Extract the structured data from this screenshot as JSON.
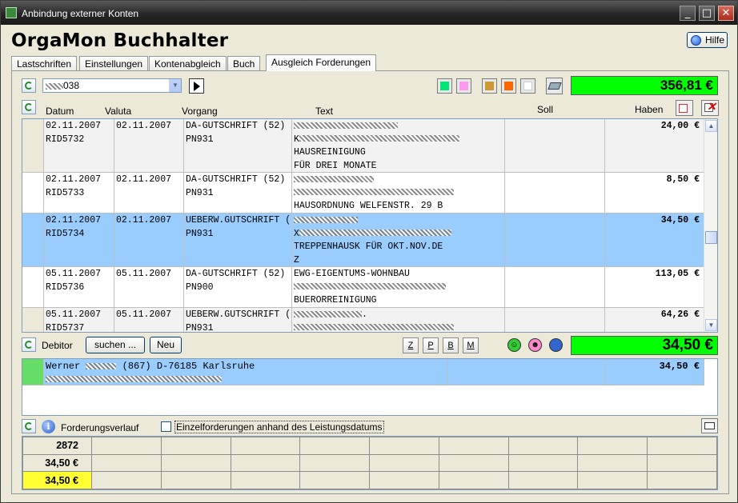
{
  "window": {
    "title": "Anbindung externer Konten",
    "min": "_",
    "max": "□",
    "close": "✕"
  },
  "app": {
    "title": "OrgaMon Buchhalter",
    "help": "Hilfe"
  },
  "tabs": [
    "Lastschriften",
    "Einstellungen",
    "Kontenabgleich",
    "Buch",
    "Ausgleich Forderungen"
  ],
  "account": {
    "value": "038"
  },
  "total_top": "356,81 €",
  "columns": {
    "datum": "Datum",
    "valuta": "Valuta",
    "vorgang": "Vorgang",
    "text": "Text",
    "soll": "Soll",
    "haben": "Haben"
  },
  "rows": [
    {
      "datum": "02.11.2007",
      "id": "RID5732",
      "valuta": "02.11.2007",
      "vorgang": "DA-GUTSCHRIFT (52)",
      "vorgang2": "PN931",
      "text": [
        "",
        "K",
        "HAUSREINIGUNG",
        "FÜR DREI MONATE"
      ],
      "haben": "24,00 €"
    },
    {
      "datum": "02.11.2007",
      "id": "RID5733",
      "valuta": "02.11.2007",
      "vorgang": "DA-GUTSCHRIFT (52)",
      "vorgang2": "PN931",
      "text": [
        "",
        "",
        "HAUSORDNUNG WELFENSTR. 29 B",
        ""
      ],
      "haben": "8,50 €"
    },
    {
      "datum": "02.11.2007",
      "id": "RID5734",
      "valuta": "02.11.2007",
      "vorgang": "UEBERW.GUTSCHRIFT (",
      "vorgang2": "PN931",
      "text": [
        "",
        "X",
        "TREPPENHAUSK FÜR OKT.NOV.DE",
        "Z"
      ],
      "haben": "34,50 €"
    },
    {
      "datum": "05.11.2007",
      "id": "RID5736",
      "valuta": "05.11.2007",
      "vorgang": "DA-GUTSCHRIFT (52)",
      "vorgang2": "PN900",
      "text": [
        "EWG-EIGENTUMS-WOHNBAU",
        "",
        "BUERORREINIGUNG",
        ""
      ],
      "haben": "113,05 €"
    },
    {
      "datum": "05.11.2007",
      "id": "RID5737",
      "valuta": "05.11.2007",
      "vorgang": "UEBERW.GUTSCHRIFT (",
      "vorgang2": "PN931",
      "text": [
        ".",
        "",
        "",
        ""
      ],
      "haben": "64,26 €"
    }
  ],
  "debitor": {
    "label": "Debitor",
    "search": "suchen ...",
    "new": "Neu",
    "flags": [
      "Z",
      "P",
      "B",
      "M"
    ],
    "total": "34,50 €",
    "entry": {
      "name": "Werner",
      "rest": "(867) D-76185 Karlsruhe",
      "amount": "34,50 €"
    }
  },
  "forderung": {
    "label": "Forderungsverlauf",
    "checkbox": "Einzelforderungen anhand des Leistungsdatums"
  },
  "bottom": {
    "r1": "2872",
    "r2": "34,50 €",
    "r3": "34,50 €"
  },
  "colors": {
    "accent_green": "#00ff00",
    "selection": "#99ccff",
    "highlight_yellow": "#ffff33"
  }
}
